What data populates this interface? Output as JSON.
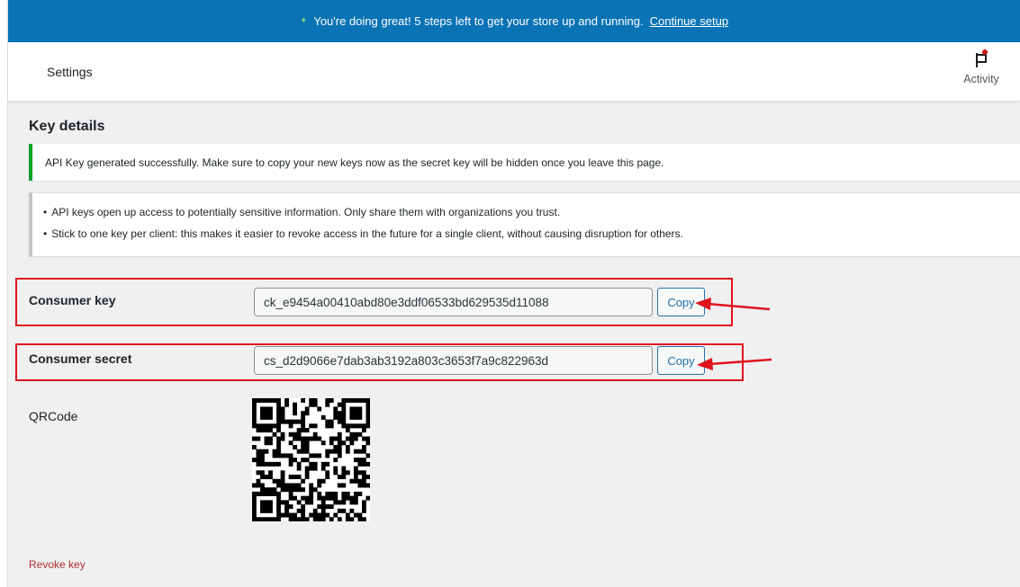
{
  "banner": {
    "message": "You're doing great! 5 steps left to get your store up and running.",
    "link": "Continue setup"
  },
  "header": {
    "title": "Settings",
    "activity_label": "Activity"
  },
  "page": {
    "section_title": "Key details",
    "success_notice": "API Key generated successfully. Make sure to copy your new keys now as the secret key will be hidden once you leave this page.",
    "info_items": [
      "API keys open up access to potentially sensitive information. Only share them with organizations you trust.",
      "Stick to one key per client: this makes it easier to revoke access in the future for a single client, without causing disruption for others."
    ]
  },
  "keys": {
    "consumer_key_label": "Consumer key",
    "consumer_key_value": "ck_e9454a00410abd80e3ddf06533bd629535d11088",
    "consumer_secret_label": "Consumer secret",
    "consumer_secret_value": "cs_d2d9066e7dab3ab3192a803c3653f7a9c822963d",
    "copy_label": "Copy"
  },
  "qr": {
    "label": "QRCode"
  },
  "revoke_label": "Revoke key",
  "colors": {
    "banner": "#0a73b5",
    "success": "#00a32a",
    "link": "#2271b1",
    "revoke": "#b32d2e",
    "annotation": "#e0141e"
  }
}
